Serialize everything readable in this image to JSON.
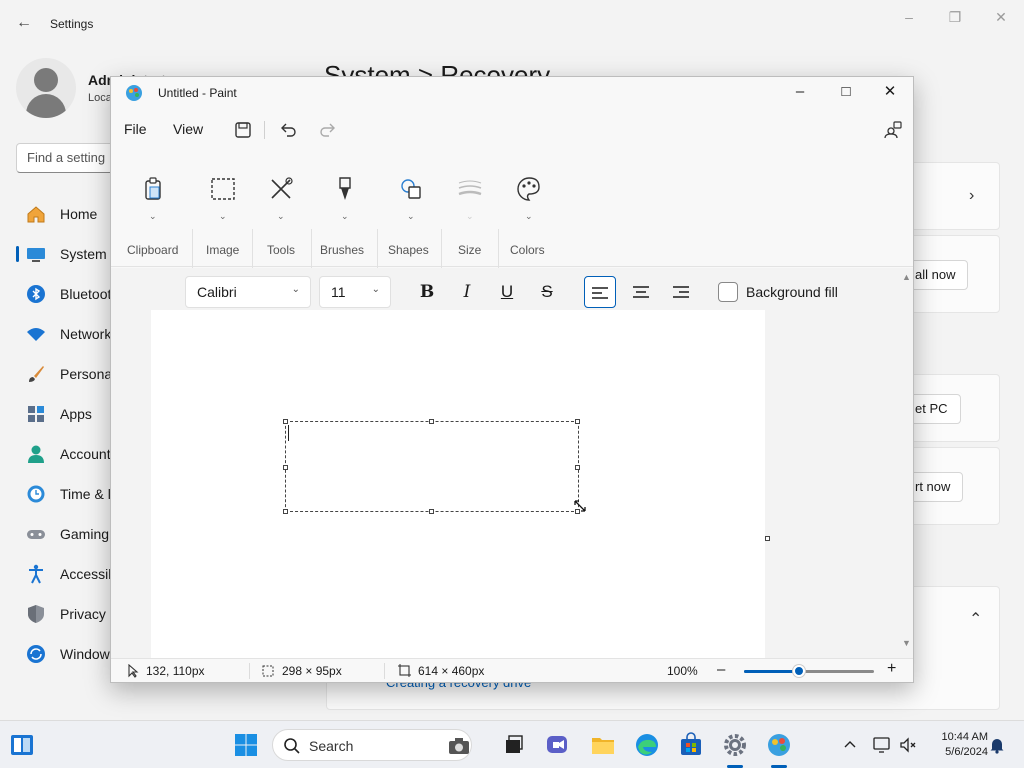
{
  "settings": {
    "title": "Settings",
    "user": {
      "name": "Administrator",
      "subtitle": "Local Account"
    },
    "search_placeholder": "Find a setting",
    "heading": "System  >  Recovery",
    "nav": [
      {
        "label": "Home",
        "icon": "home-icon"
      },
      {
        "label": "System",
        "icon": "system-icon"
      },
      {
        "label": "Bluetooth & devices",
        "icon": "bluetooth-icon"
      },
      {
        "label": "Network & internet",
        "icon": "wifi-icon"
      },
      {
        "label": "Personalization",
        "icon": "brush-icon"
      },
      {
        "label": "Apps",
        "icon": "apps-icon"
      },
      {
        "label": "Accounts",
        "icon": "account-icon"
      },
      {
        "label": "Time & language",
        "icon": "clock-globe-icon"
      },
      {
        "label": "Gaming",
        "icon": "gamepad-icon"
      },
      {
        "label": "Accessibility",
        "icon": "accessibility-icon"
      },
      {
        "label": "Privacy & security",
        "icon": "shield-icon"
      },
      {
        "label": "Windows Update",
        "icon": "update-icon"
      }
    ],
    "card_buttons": [
      "Fix problems using Windows Update now",
      "Reset PC",
      "Restart now"
    ],
    "card_button_visible": [
      "all now",
      "et PC",
      "rt now"
    ],
    "link": "Creating a recovery drive"
  },
  "paint": {
    "title": "Untitled - Paint",
    "menu": {
      "file": "File",
      "view": "View"
    },
    "ribbon": [
      {
        "label": "Clipboard",
        "icon": "clipboard-icon"
      },
      {
        "label": "Image",
        "icon": "select-rectangle-icon"
      },
      {
        "label": "Tools",
        "icon": "tools-icon"
      },
      {
        "label": "Brushes",
        "icon": "brush-icon"
      },
      {
        "label": "Shapes",
        "icon": "shapes-icon"
      },
      {
        "label": "Size",
        "icon": "size-icon"
      },
      {
        "label": "Colors",
        "icon": "palette-icon"
      }
    ],
    "text_toolbar": {
      "font": "Calibri",
      "size": "11",
      "background_fill": "Background fill"
    },
    "status": {
      "cursor": "132, 110px",
      "selection": "298 × 95px",
      "canvas": "614 × 460px",
      "zoom": "100%",
      "zoom_level": 0.42
    }
  },
  "taskbar": {
    "search": "Search",
    "time": "10:44 AM",
    "date": "5/6/2024"
  },
  "colors": {
    "accent": "#005fb8"
  }
}
